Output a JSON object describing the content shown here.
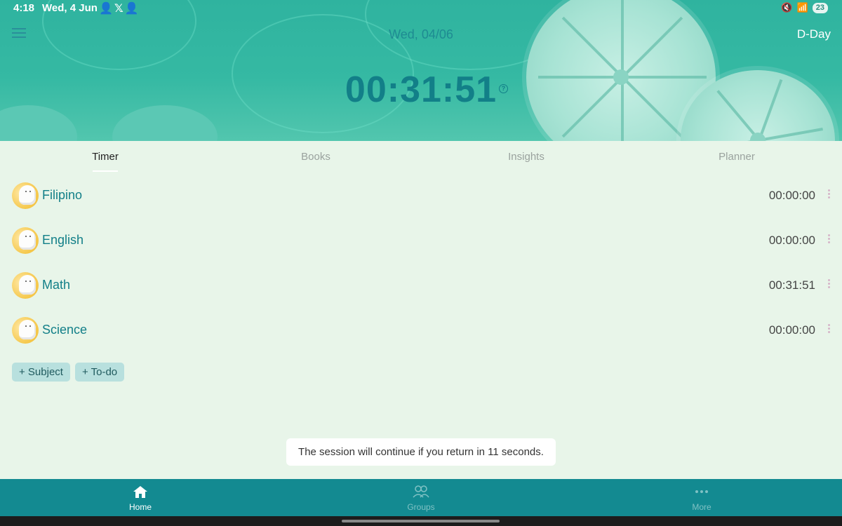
{
  "status_bar": {
    "time": "4:18",
    "date": "Wed, 4 Jun",
    "battery": "23"
  },
  "header": {
    "date": "Wed, 04/06",
    "dday_label": "D-Day",
    "total_timer": "00:31:51"
  },
  "tabs": [
    {
      "label": "Timer",
      "active": true
    },
    {
      "label": "Books",
      "active": false
    },
    {
      "label": "Insights",
      "active": false
    },
    {
      "label": "Planner",
      "active": false
    }
  ],
  "subjects": [
    {
      "name": "Filipino",
      "time": "00:00:00"
    },
    {
      "name": "English",
      "time": "00:00:00"
    },
    {
      "name": "Math",
      "time": "00:31:51"
    },
    {
      "name": "Science",
      "time": "00:00:00"
    }
  ],
  "actions": {
    "add_subject": "+ Subject",
    "add_todo": "+ To-do"
  },
  "toast": "The session will continue if you return in 11 seconds.",
  "bottom_nav": [
    {
      "label": "Home",
      "icon": "home-icon",
      "active": true
    },
    {
      "label": "Groups",
      "icon": "groups-icon",
      "active": false
    },
    {
      "label": "More",
      "icon": "more-icon",
      "active": false
    }
  ],
  "colors": {
    "accent": "#127f88",
    "banner": "#35b9a3",
    "nav": "#138a91",
    "background": "#e8f5e9"
  }
}
